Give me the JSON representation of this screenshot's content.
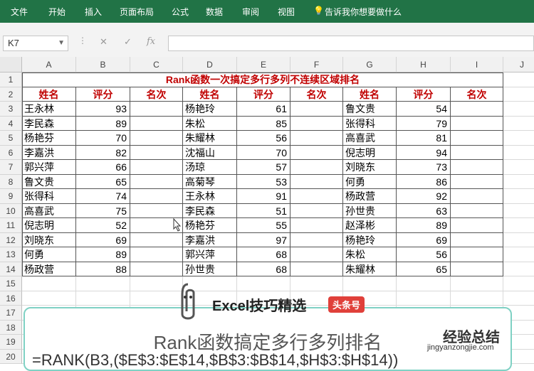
{
  "menu": [
    "文件",
    "开始",
    "插入",
    "页面布局",
    "公式",
    "数据",
    "审阅",
    "视图"
  ],
  "tell_me": "告诉我你想要做什么",
  "name_box": "K7",
  "fx_label": "fx",
  "columns": [
    "A",
    "B",
    "C",
    "D",
    "E",
    "F",
    "G",
    "H",
    "I",
    "J"
  ],
  "rows": [
    "1",
    "2",
    "3",
    "4",
    "5",
    "6",
    "7",
    "8",
    "9",
    "10",
    "11",
    "12",
    "13",
    "14",
    "15",
    "16",
    "17",
    "18",
    "19",
    "20"
  ],
  "sheet_title": "Rank函数一次搞定多行多列不连续区域排名",
  "headers": [
    "姓名",
    "评分",
    "名次",
    "姓名",
    "评分",
    "名次",
    "姓名",
    "评分",
    "名次"
  ],
  "table": [
    [
      "王永林",
      "93",
      "",
      "杨艳玲",
      "61",
      "",
      "鲁文贵",
      "54",
      ""
    ],
    [
      "李民森",
      "89",
      "",
      "朱松",
      "85",
      "",
      "张得科",
      "79",
      ""
    ],
    [
      "杨艳芬",
      "70",
      "",
      "朱耀林",
      "56",
      "",
      "高喜武",
      "81",
      ""
    ],
    [
      "李嘉洪",
      "82",
      "",
      "沈福山",
      "70",
      "",
      "倪志明",
      "94",
      ""
    ],
    [
      "郭兴萍",
      "66",
      "",
      "汤琼",
      "57",
      "",
      "刘晓东",
      "73",
      ""
    ],
    [
      "鲁文贵",
      "65",
      "",
      "高菊琴",
      "53",
      "",
      "何勇",
      "86",
      ""
    ],
    [
      "张得科",
      "74",
      "",
      "王永林",
      "91",
      "",
      "杨政营",
      "92",
      ""
    ],
    [
      "高喜武",
      "75",
      "",
      "李民森",
      "51",
      "",
      "孙世贵",
      "63",
      ""
    ],
    [
      "倪志明",
      "52",
      "",
      "杨艳芬",
      "55",
      "",
      "赵泽彬",
      "89",
      ""
    ],
    [
      "刘晓东",
      "69",
      "",
      "李嘉洪",
      "97",
      "",
      "杨艳玲",
      "69",
      ""
    ],
    [
      "何勇",
      "89",
      "",
      "郭兴萍",
      "68",
      "",
      "朱松",
      "56",
      ""
    ],
    [
      "杨政营",
      "88",
      "",
      "孙世贵",
      "68",
      "",
      "朱耀林",
      "65",
      ""
    ]
  ],
  "overlay": {
    "brand": "Excel技巧精选",
    "brand_badge": "头条号",
    "title": "Rank函数搞定多行多列排名",
    "formula": "=RANK(B3,($E$3:$E$14,$B$3:$B$14,$H$3:$H$14))"
  },
  "watermark": {
    "main": "经验总结",
    "url": "jingyanzongjie.com"
  },
  "colors": {
    "ribbon": "#217346",
    "header_text": "#c00000",
    "overlay_border": "#7fd1c4",
    "badge": "#e0403a"
  }
}
